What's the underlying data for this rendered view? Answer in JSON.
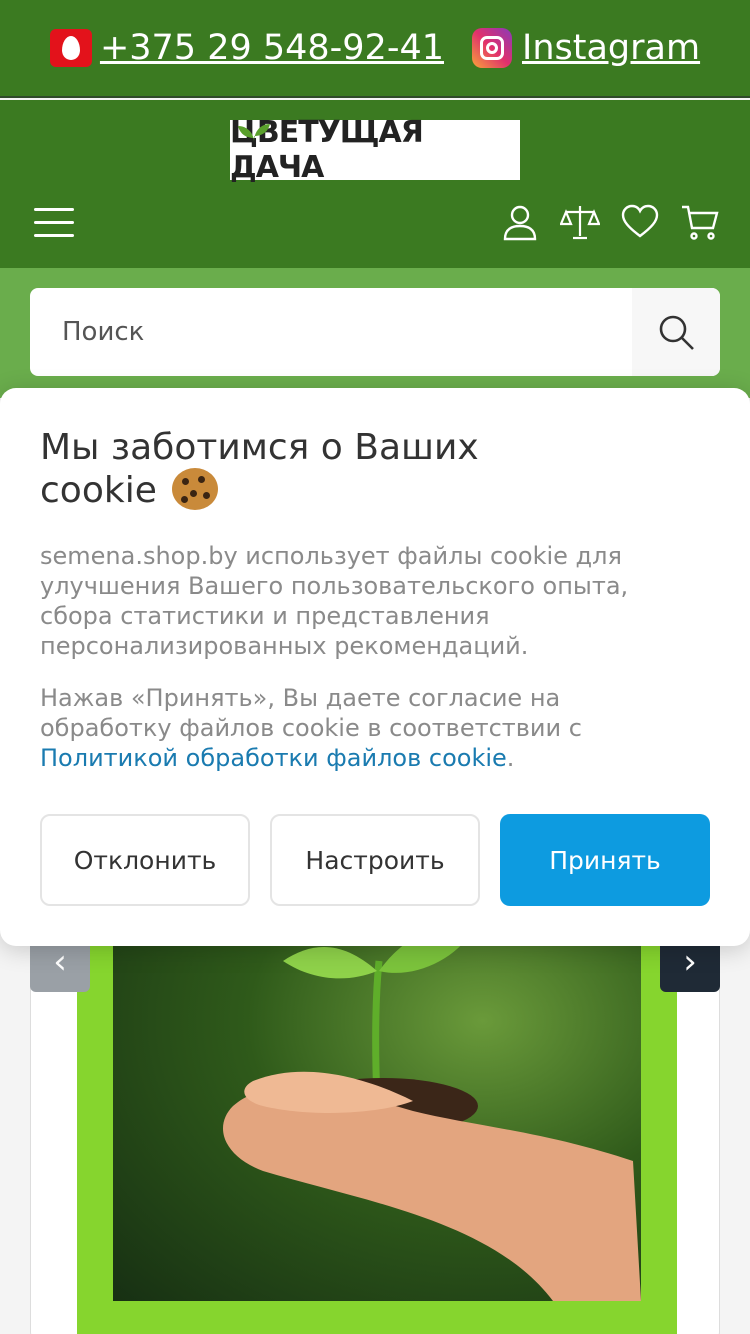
{
  "topbar": {
    "phone": "+375 29 548-92-41",
    "phone_icon": "operator-icon",
    "instagram": "Instagram",
    "instagram_icon": "instagram-icon"
  },
  "header": {
    "logo_text": "ЦВЕТУЩАЯ ДАЧА",
    "icons": [
      "menu-icon",
      "user-icon",
      "compare-icon",
      "heart-icon",
      "cart-icon"
    ]
  },
  "search": {
    "placeholder": "Поиск"
  },
  "cookie_banner": {
    "title": "Мы заботимся о Ваших cookie",
    "paragraph1": "semena.shop.by использует файлы cookie для улучшения Вашего пользовательского опыта, сбора статистики и представления персонализированных рекомендаций.",
    "paragraph2_prefix": "Нажав «Принять», Вы даете согласие на обработку файлов cookie в соответствии с ",
    "paragraph2_link": "Политикой обработки файлов cookie",
    "paragraph2_suffix": ".",
    "decline_label": "Отклонить",
    "customize_label": "Настроить",
    "accept_label": "Принять"
  },
  "slider": {
    "prev": "‹",
    "next": "›"
  },
  "colors": {
    "header_green": "#3b7a21",
    "search_zone_green": "#6aad4c",
    "accept_blue": "#0d9be0",
    "slide_green": "#86d52e"
  }
}
